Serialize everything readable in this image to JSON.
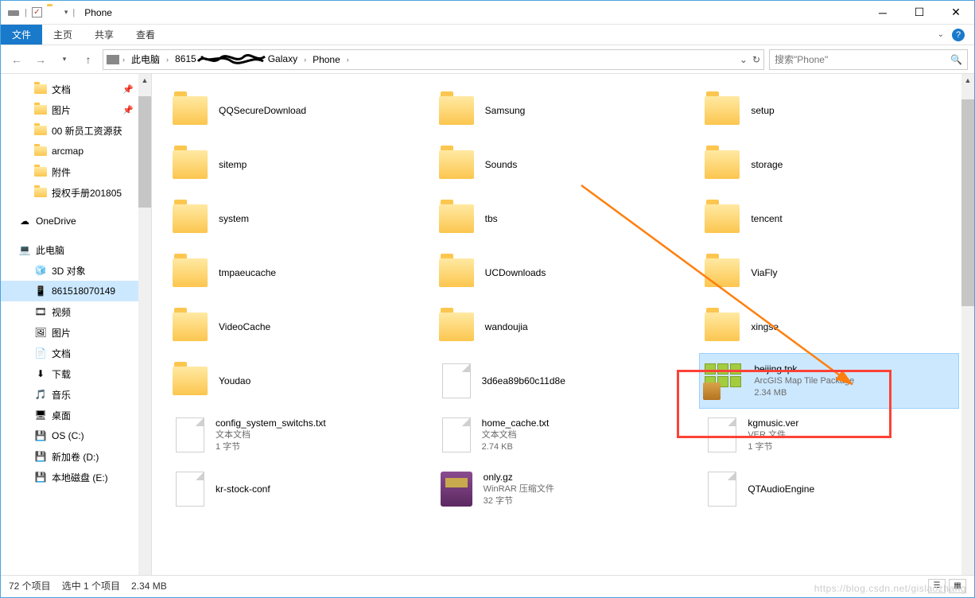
{
  "window": {
    "title": "Phone"
  },
  "ribbon": {
    "tabs": [
      {
        "label": "文件"
      },
      {
        "label": "主页"
      },
      {
        "label": "共享"
      },
      {
        "label": "查看"
      }
    ]
  },
  "breadcrumbs": {
    "c0": "此电脑",
    "c1_prefix": "8615",
    "c1_suffix": "Galaxy",
    "c2": "Phone"
  },
  "search": {
    "placeholder": "搜索\"Phone\""
  },
  "sidebar": {
    "items": [
      {
        "label": "文档",
        "pinned": true
      },
      {
        "label": "图片",
        "pinned": true
      },
      {
        "label": "00 新员工资源获"
      },
      {
        "label": "arcmap"
      },
      {
        "label": "附件"
      },
      {
        "label": "授权手册201805"
      }
    ],
    "onedrive": "OneDrive",
    "thispc": "此电脑",
    "pcitems": [
      {
        "label": "3D 对象"
      },
      {
        "label": "861518070149",
        "selected": true
      },
      {
        "label": "视频"
      },
      {
        "label": "图片"
      },
      {
        "label": "文档"
      },
      {
        "label": "下载"
      },
      {
        "label": "音乐"
      },
      {
        "label": "桌面"
      },
      {
        "label": "OS (C:)"
      },
      {
        "label": "新加卷 (D:)"
      },
      {
        "label": "本地磁盘 (E:)"
      }
    ]
  },
  "files": [
    {
      "name": "QQSecureDownload",
      "type": "folder"
    },
    {
      "name": "Samsung",
      "type": "folder"
    },
    {
      "name": "setup",
      "type": "folder"
    },
    {
      "name": "sitemp",
      "type": "folder"
    },
    {
      "name": "Sounds",
      "type": "folder"
    },
    {
      "name": "storage",
      "type": "folder"
    },
    {
      "name": "system",
      "type": "folder"
    },
    {
      "name": "tbs",
      "type": "folder"
    },
    {
      "name": "tencent",
      "type": "folder"
    },
    {
      "name": "tmpaeucache",
      "type": "folder"
    },
    {
      "name": "UCDownloads",
      "type": "folder"
    },
    {
      "name": "ViaFly",
      "type": "folder"
    },
    {
      "name": "VideoCache",
      "type": "folder"
    },
    {
      "name": "wandoujia",
      "type": "folder"
    },
    {
      "name": "xingse",
      "type": "folder"
    },
    {
      "name": "Youdao",
      "type": "folder"
    },
    {
      "name": "3d6ea89b60c11d8e",
      "type": "file"
    },
    {
      "name": "beijing.tpk",
      "sub1": "ArcGIS Map Tile Package",
      "sub2": "2.34 MB",
      "type": "tpk",
      "selected": true
    },
    {
      "name": "config_system_switchs.txt",
      "sub1": "文本文档",
      "sub2": "1 字节",
      "type": "file"
    },
    {
      "name": "home_cache.txt",
      "sub1": "文本文档",
      "sub2": "2.74 KB",
      "type": "file"
    },
    {
      "name": "kgmusic.ver",
      "sub1": "VER 文件",
      "sub2": "1 字节",
      "type": "file"
    },
    {
      "name": "kr-stock-conf",
      "type": "file"
    },
    {
      "name": "only.gz",
      "sub1": "WinRAR 压缩文件",
      "sub2": "32 字节",
      "type": "rar"
    },
    {
      "name": "QTAudioEngine",
      "type": "file"
    }
  ],
  "status": {
    "count": "72 个项目",
    "selected": "选中 1 个项目",
    "size": "2.34 MB"
  },
  "watermark": "https://blog.csdn.net/gislaozhang"
}
